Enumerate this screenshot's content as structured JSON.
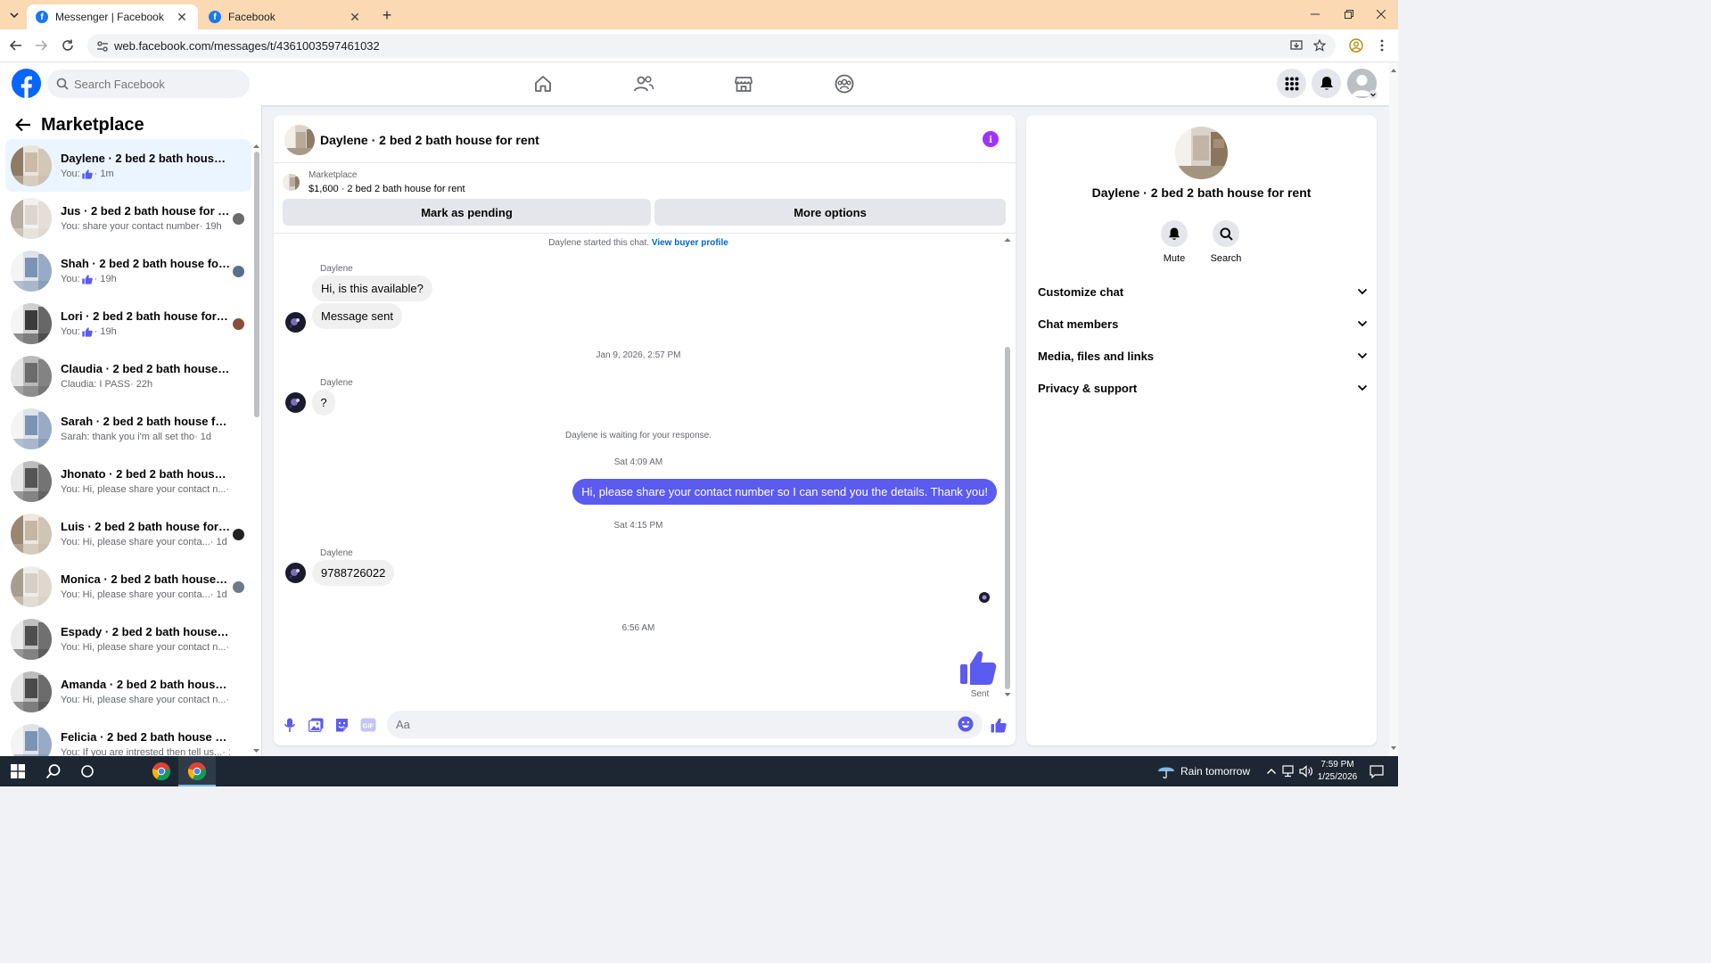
{
  "browser": {
    "tabs": [
      {
        "title": "Messenger | Facebook",
        "active": true
      },
      {
        "title": "Facebook",
        "active": false
      }
    ],
    "url": "web.facebook.com/messages/t/4361003597461032"
  },
  "fb": {
    "search_placeholder": "Search Facebook",
    "accent": "#0866ff"
  },
  "sidebar": {
    "title": "Marketplace",
    "conversations": [
      {
        "title": "Daylene · 2 bed 2 bath house fo...",
        "preview": "You: ",
        "like": true,
        "time": "· 1m"
      },
      {
        "title": "Jus · 2 bed 2 bath house for r...",
        "preview": "You: share your contact number",
        "like": false,
        "time": "· 19h"
      },
      {
        "title": "Shah · 2 bed 2 bath house for ...",
        "preview": "You: ",
        "like": true,
        "time": "· 19h"
      },
      {
        "title": "Lori · 2 bed 2 bath house for r...",
        "preview": "You: ",
        "like": true,
        "time": "· 19h"
      },
      {
        "title": "Claudia · 2 bed 2 bath house for...",
        "preview": "Claudia: I PASS",
        "like": false,
        "time": "· 22h"
      },
      {
        "title": "Sarah · 2 bed 2 bath house for r...",
        "preview": "Sarah: thank you i'm all set tho",
        "like": false,
        "time": "· 1d"
      },
      {
        "title": "Jhonato · 2 bed 2 bath house fo...",
        "preview": "You: Hi, please share your contact n...",
        "like": false,
        "time": "· 1d"
      },
      {
        "title": "Luis · 2 bed 2 bath house for r...",
        "preview": "You: Hi, please share your conta...",
        "like": false,
        "time": "· 1d"
      },
      {
        "title": "Monica · 2 bed 2 bath house f...",
        "preview": "You: Hi, please share your conta...",
        "like": false,
        "time": "· 1d"
      },
      {
        "title": "Espady · 2 bed 2 bath house for ...",
        "preview": "You: Hi, please share your contact n...",
        "like": false,
        "time": "· 1d"
      },
      {
        "title": "Amanda · 2 bed 2 bath house fo...",
        "preview": "You: Hi, please share your contact n...",
        "like": false,
        "time": "· 1d"
      },
      {
        "title": "Felicia · 2 bed 2 bath house for r...",
        "preview": "You: If you are intrested then tell us...",
        "like": false,
        "time": "· 1d"
      }
    ]
  },
  "chat": {
    "title": "Daylene · 2 bed 2 bath house for rent",
    "listing_kind": "Marketplace",
    "listing_price": "$1,600 · 2 bed 2 bath house for rent",
    "mark_pending": "Mark as pending",
    "more_options": "More options",
    "started_text": "Daylene started this chat.",
    "buyer_profile_link": "View buyer profile",
    "sender_name": "Daylene",
    "msg1": "Hi, is this available?",
    "msg2": "Message sent",
    "ts1": "Jan 9, 2026, 2:57 PM",
    "msg3": "?",
    "waiting": "Daylene is waiting for your response.",
    "ts2": "Sat 4:09 AM",
    "my_msg": "Hi, please share your contact number so I can send you the details. Thank you!",
    "ts3": "Sat 4:15 PM",
    "msg4": "9788726022",
    "ts4": "6:56 AM",
    "sent_label": "Sent",
    "composer_placeholder": "Aa",
    "bubble_color": "#5b5bf0"
  },
  "details": {
    "name": "Daylene · 2 bed 2 bath house for rent",
    "mute": "Mute",
    "search": "Search",
    "sections": [
      "Customize chat",
      "Chat members",
      "Media, files and links",
      "Privacy & support"
    ]
  },
  "taskbar": {
    "weather": "Rain tomorrow",
    "time": "7:59 PM",
    "date": "1/25/2026"
  }
}
